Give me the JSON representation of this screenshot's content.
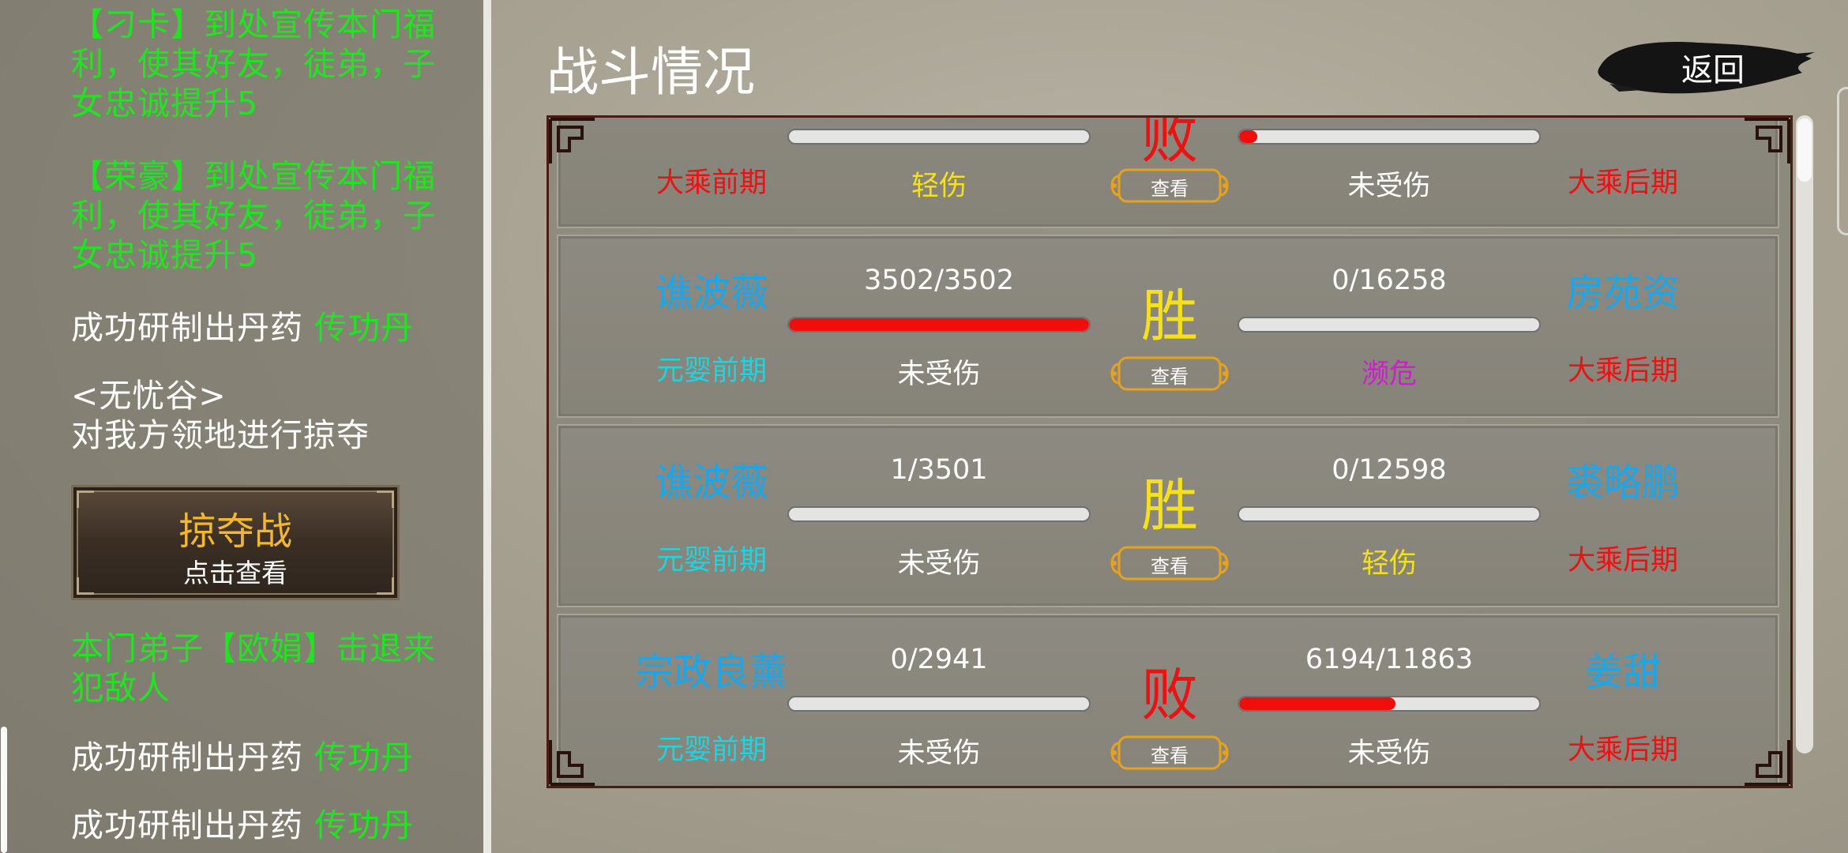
{
  "log": {
    "entries": [
      {
        "text": "【刁卡】到处宣传本门福利，使其好友，徒弟，子女忠诚提升5"
      },
      {
        "text": "【荣豪】到处宣传本门福利，使其好友，徒弟，子女忠诚提升5"
      },
      {
        "prefix": "成功研制出丹药 ",
        "highlight": "传功丹"
      },
      {
        "line1": "<无忧谷>",
        "line2": "对我方领地进行掠夺"
      },
      {
        "text": "本门弟子【欧娟】击退来犯敌人"
      },
      {
        "prefix": "成功研制出丹药 ",
        "highlight": "传功丹"
      },
      {
        "prefix": "成功研制出丹药 ",
        "highlight": "传功丹"
      }
    ],
    "raid_card": {
      "title": "掠夺战",
      "subtitle": "点击查看"
    }
  },
  "header": {
    "title": "战斗情况",
    "back_label": "返回"
  },
  "battles": [
    {
      "left_name": "",
      "left_realm": "大乘前期",
      "left_hp": "",
      "left_hp_fraction": 0.0,
      "left_status": "轻伤",
      "result": "败",
      "right_name": "",
      "right_realm": "大乘后期",
      "right_hp": "",
      "right_hp_fraction": 0.06,
      "right_status": "未受伤",
      "view_label": "查看"
    },
    {
      "left_name": "谯波薇",
      "left_realm": "元婴前期",
      "left_hp": "3502/3502",
      "left_hp_fraction": 1.0,
      "left_status": "未受伤",
      "result": "胜",
      "right_name": "房苑资",
      "right_realm": "大乘后期",
      "right_hp": "0/16258",
      "right_hp_fraction": 0.0,
      "right_status": "濒危",
      "view_label": "查看"
    },
    {
      "left_name": "谯波薇",
      "left_realm": "元婴前期",
      "left_hp": "1/3501",
      "left_hp_fraction": 0.0,
      "left_status": "未受伤",
      "result": "胜",
      "right_name": "裘略鹏",
      "right_realm": "大乘后期",
      "right_hp": "0/12598",
      "right_hp_fraction": 0.0,
      "right_status": "轻伤",
      "view_label": "查看"
    },
    {
      "left_name": "宗政良薰",
      "left_realm": "元婴前期",
      "left_hp": "0/2941",
      "left_hp_fraction": 0.0,
      "left_status": "未受伤",
      "result": "败",
      "right_name": "姜甜",
      "right_realm": "大乘后期",
      "right_hp": "6194/11863",
      "right_hp_fraction": 0.522,
      "right_status": "未受伤",
      "view_label": "查看"
    }
  ],
  "colors": {
    "accent_green": "#1ee61e",
    "gold": "#f2b632",
    "hp_red": "#f20d0d",
    "win_yellow": "#f5e01a",
    "lose_red": "#ee1111",
    "name_blue": "#1aa6e8",
    "realm_cyan": "#19d6e0"
  }
}
